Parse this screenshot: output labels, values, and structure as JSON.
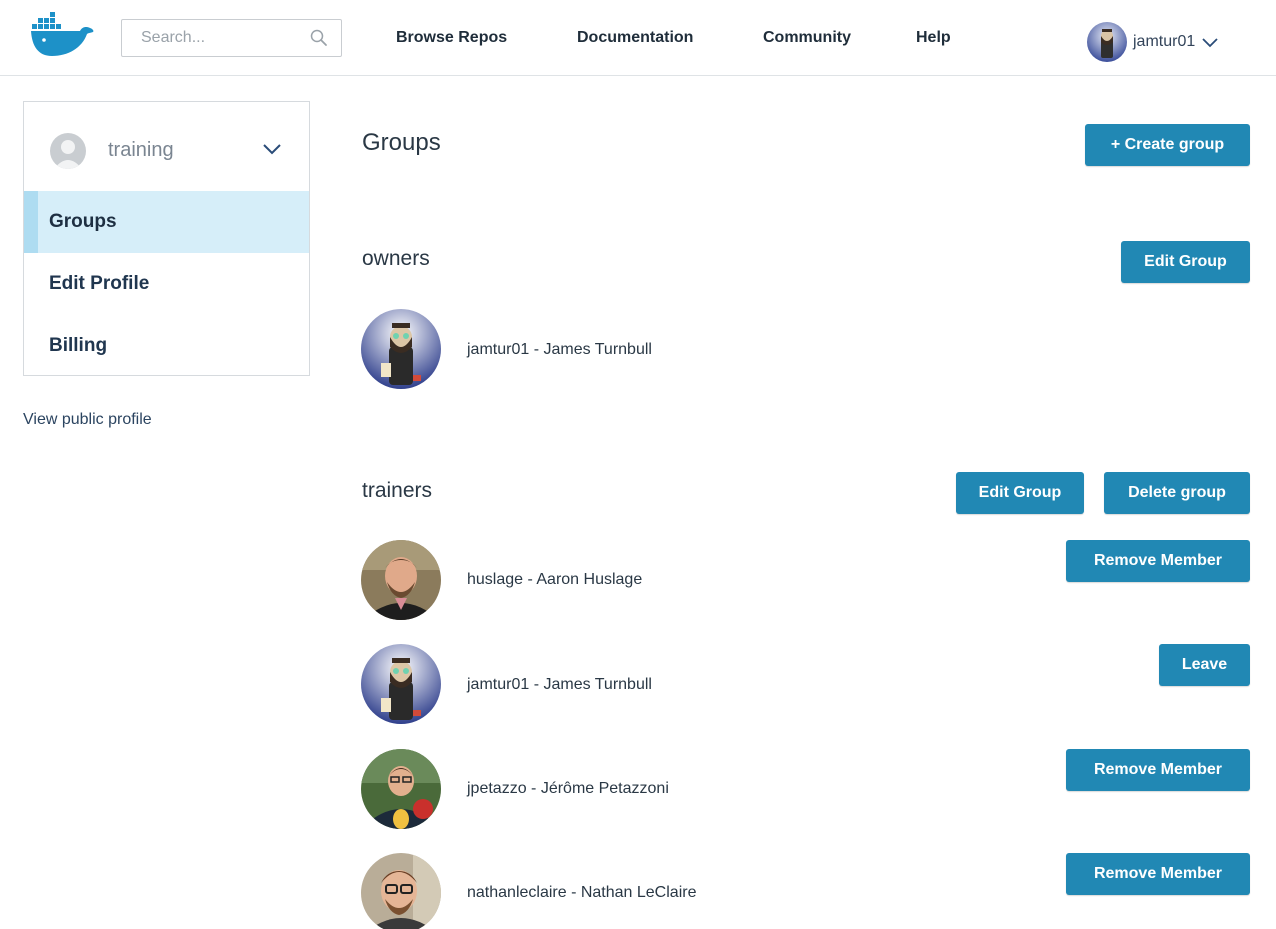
{
  "header": {
    "search_placeholder": "Search...",
    "nav": [
      "Browse Repos",
      "Documentation",
      "Community",
      "Help"
    ],
    "username": "jamtur01"
  },
  "sidebar": {
    "org_name": "training",
    "items": [
      {
        "label": "Groups",
        "active": true
      },
      {
        "label": "Edit Profile",
        "active": false
      },
      {
        "label": "Billing",
        "active": false
      }
    ],
    "public_profile_link": "View public profile"
  },
  "main": {
    "title": "Groups",
    "create_button": "+ Create group",
    "groups": [
      {
        "name": "owners",
        "buttons": [
          "Edit Group"
        ],
        "members": [
          {
            "text": "jamtur01 - James Turnbull",
            "action": ""
          }
        ]
      },
      {
        "name": "trainers",
        "buttons": [
          "Edit Group",
          "Delete group"
        ],
        "members": [
          {
            "text": "huslage - Aaron Huslage",
            "action": "Remove Member"
          },
          {
            "text": "jamtur01 - James Turnbull",
            "action": "Leave"
          },
          {
            "text": "jpetazzo - Jérôme Petazzoni",
            "action": "Remove Member"
          },
          {
            "text": "nathanleclaire - Nathan LeClaire",
            "action": "Remove Member"
          }
        ]
      }
    ]
  },
  "colors": {
    "primary_button": "#2188b4",
    "active_sidebar_bg": "#d6eef9",
    "docker_blue": "#1d91c8"
  }
}
